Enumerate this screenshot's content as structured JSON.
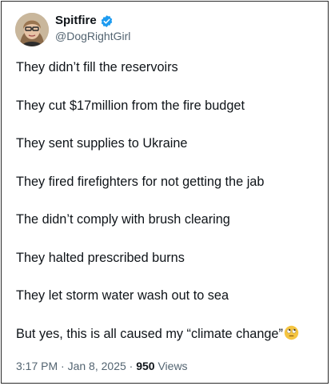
{
  "author": {
    "display_name": "Spitfire",
    "handle": "@DogRightGirl",
    "verified_icon": "verified-badge-icon",
    "verified_color": "#1d9bf0"
  },
  "tweet": {
    "lines": [
      "They didn’t fill the reservoirs",
      "They cut $17million from the fire budget",
      "They sent supplies to Ukraine",
      "They fired firefighters for not getting the jab",
      "The didn’t comply with brush clearing",
      "They halted prescribed burns",
      "They let storm water wash out to sea",
      "But yes, this is all caused my “climate change”"
    ],
    "trailing_emoji": "face-with-rolling-eyes-icon"
  },
  "meta": {
    "time": "3:17 PM",
    "separator": "·",
    "date": "Jan 8, 2025",
    "views_count": "950",
    "views_label": "Views"
  },
  "colors": {
    "text_primary": "#0f1419",
    "text_secondary": "#536471",
    "border": "#2b2b2b"
  }
}
